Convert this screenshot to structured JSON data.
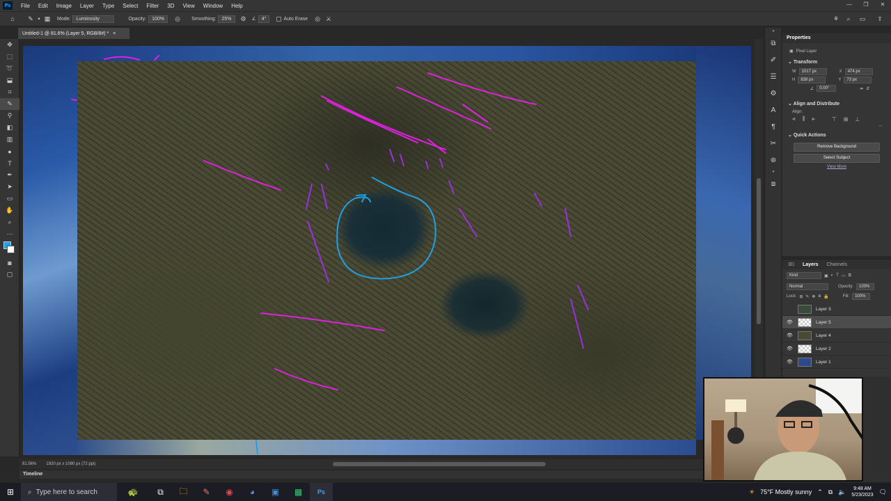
{
  "app": {
    "logo_text": "Ps"
  },
  "menu": [
    "File",
    "Edit",
    "Image",
    "Layer",
    "Type",
    "Select",
    "Filter",
    "3D",
    "View",
    "Window",
    "Help"
  ],
  "options": {
    "mode_label": "Mode:",
    "mode_value": "Luminosity",
    "opacity_label": "Opacity:",
    "opacity_value": "100%",
    "smoothing_label": "Smoothing:",
    "smoothing_value": "25%",
    "angle_value": "4°",
    "auto_erase_label": "Auto Erase"
  },
  "document_tab": {
    "title": "Untitled-1 @ 81.6% (Layer 5, RGB/8#) *",
    "close": "×"
  },
  "status": {
    "zoom": "81.56%",
    "dims": "1920 px x 1080 px (72 ppi)"
  },
  "timeline_label": "Timeline",
  "properties": {
    "tab": "Properties",
    "kind": "Pixel Layer",
    "transform_header": "Transform",
    "w_label": "W",
    "w_value": "1017 px",
    "x_label": "X",
    "x_value": "474 px",
    "h_label": "H",
    "h_value": "838 px",
    "y_label": "Y",
    "y_value": "73 px",
    "angle_value": "0.00°",
    "align_header": "Align and Distribute",
    "align_label": "Align:",
    "quick_header": "Quick Actions",
    "remove_bg": "Remove Background",
    "select_subject": "Select Subject",
    "view_more": "View More"
  },
  "layers_panel": {
    "tabs": [
      "3D",
      "Layers",
      "Channels"
    ],
    "filter": "Kind",
    "blend": "Normal",
    "opacity_label": "Opacity:",
    "opacity_value": "100%",
    "lock_label": "Lock:",
    "fill_label": "Fill:",
    "fill_value": "100%",
    "layers": [
      {
        "name": "Layer 3",
        "visible": false,
        "selected": false
      },
      {
        "name": "Layer 5",
        "visible": true,
        "selected": true
      },
      {
        "name": "Layer 4",
        "visible": true,
        "selected": false
      },
      {
        "name": "Layer 2",
        "visible": true,
        "selected": false
      },
      {
        "name": "Layer 1",
        "visible": true,
        "selected": false
      }
    ]
  },
  "taskbar": {
    "search_placeholder": "Type here to search",
    "weather": "75°F  Mostly sunny",
    "time": "9:48 AM",
    "date": "5/23/2023"
  },
  "colors": {
    "magenta": "#e020e0",
    "purple": "#8a2be2",
    "cyan": "#1ea0e8",
    "accent": "#31a8ff"
  }
}
